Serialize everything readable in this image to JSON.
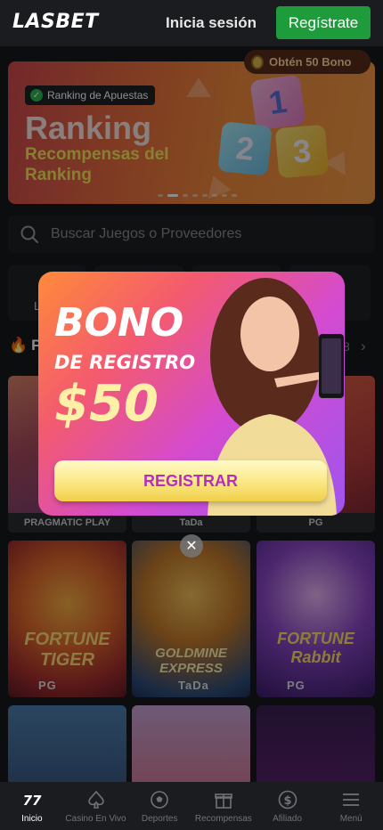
{
  "header": {
    "logo": "LASBET",
    "login_label": "Inicia sesión",
    "register_label": "Regístrate",
    "bonus_pill": "Obtén 50 Bono"
  },
  "banner": {
    "badge": "Ranking de Apuestas",
    "title": "Ranking",
    "subtitle": "Recompensas del Ranking",
    "cubes": [
      "1",
      "2",
      "3"
    ],
    "slide_count": 8,
    "active_slide": 2
  },
  "search": {
    "placeholder": "Buscar Juegos o Proveedores"
  },
  "categories": {
    "first_label": "L"
  },
  "section": {
    "title": "P",
    "count": "8"
  },
  "games": [
    {
      "title": "",
      "provider": "PRAGMATIC PLAY"
    },
    {
      "title": "",
      "provider": "TaDa"
    },
    {
      "title": "",
      "provider": "PG"
    },
    {
      "title": "FORTUNE TIGER",
      "provider": "PG"
    },
    {
      "title": "GOLDMINE EXPRESS",
      "provider": "TaDa"
    },
    {
      "title": "FORTUNE Rabbit",
      "provider": "PG"
    }
  ],
  "popup": {
    "title": "BONO",
    "subtitle": "DE REGISTRO",
    "amount": "$50",
    "button": "REGISTRAR",
    "close": "✕"
  },
  "nav": [
    {
      "label": "Inicio",
      "icon": "home-777-icon",
      "active": true
    },
    {
      "label": "Casino En Vivo",
      "icon": "spade-icon",
      "active": false
    },
    {
      "label": "Deportes",
      "icon": "soccer-ball-icon",
      "active": false
    },
    {
      "label": "Recompensas",
      "icon": "gift-icon",
      "active": false
    },
    {
      "label": "Afiliado",
      "icon": "dollar-coin-icon",
      "active": false
    },
    {
      "label": "Menú",
      "icon": "menu-icon",
      "active": false
    }
  ],
  "colors": {
    "accent_green": "#1e9c3c",
    "background": "#16181c",
    "popup_button_text": "#b82bc4"
  }
}
